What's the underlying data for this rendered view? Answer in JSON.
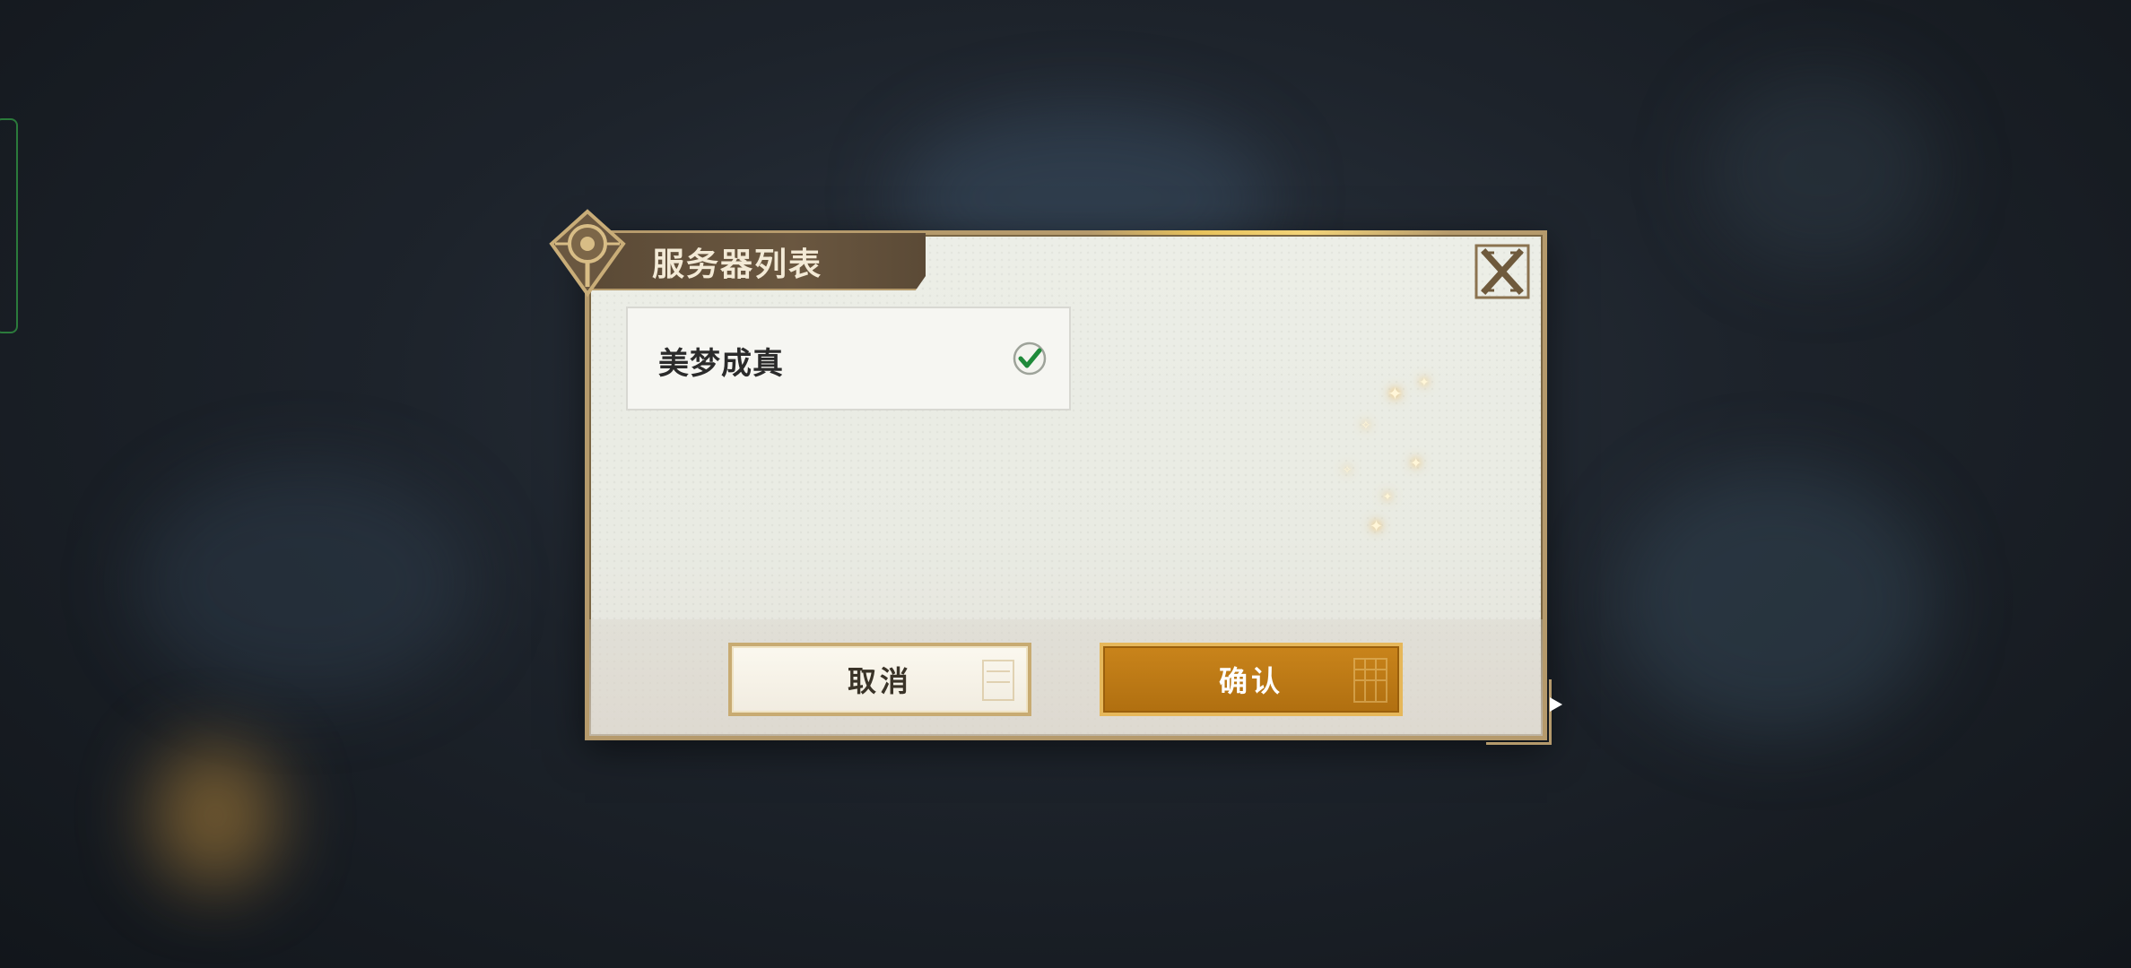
{
  "dialog": {
    "title": "服务器列表",
    "close_icon": "close-x-icon",
    "emblem_icon": "compass-emblem-icon",
    "servers": [
      {
        "name": "美梦成真",
        "selected": true,
        "status_icon": "check-circle-icon"
      }
    ],
    "cancel_label": "取消",
    "confirm_label": "确认"
  },
  "colors": {
    "frame": "#b59a6c",
    "title_plate": "#5b4a36",
    "confirm_bg": "#b87513",
    "check": "#1f8a3a",
    "panel_bg": "#eceee7"
  }
}
